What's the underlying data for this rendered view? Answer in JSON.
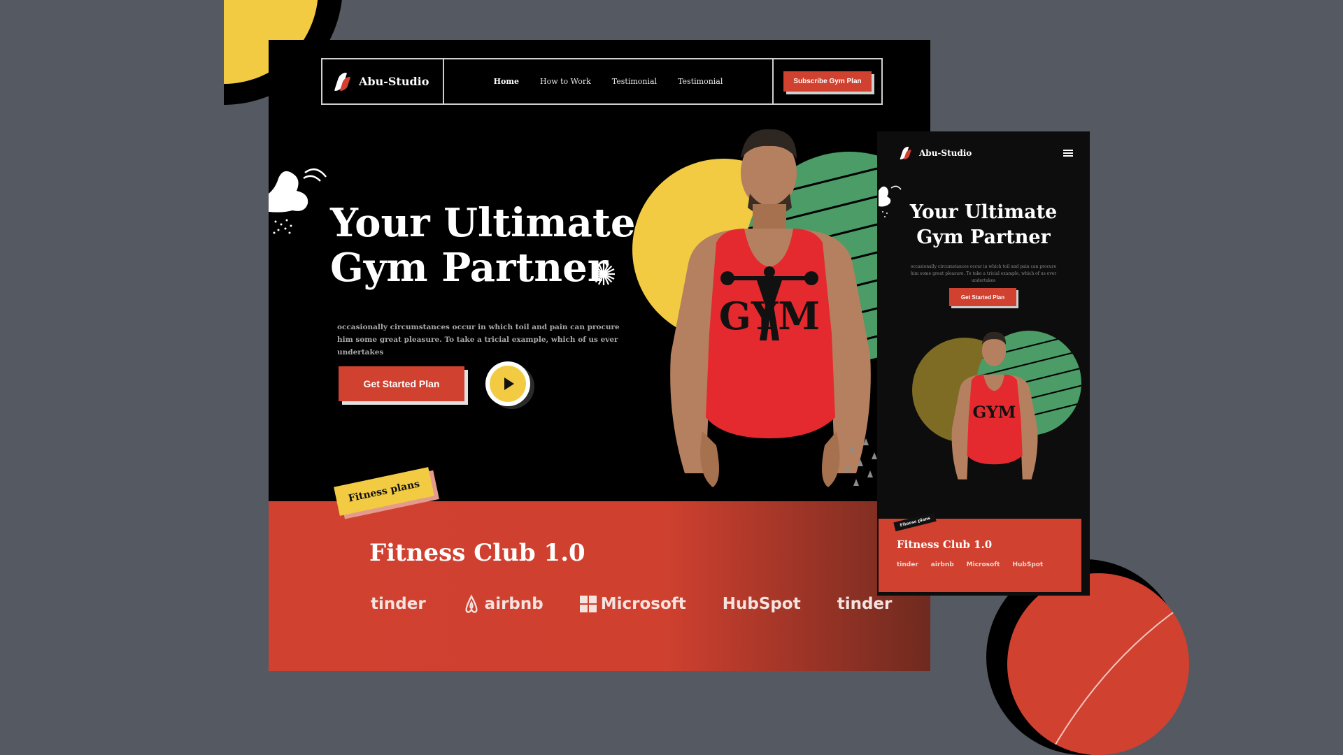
{
  "colors": {
    "background": "#545962",
    "accent_red": "#d14130",
    "accent_yellow": "#f3cb43",
    "accent_green": "#4b9c67",
    "dark": "#000000",
    "white": "#ffffff"
  },
  "desktop": {
    "brand": {
      "name": "Abu-Studio",
      "icon": "flame-logo-icon"
    },
    "nav": {
      "links": [
        "Home",
        "How to Work",
        "Testimonial",
        "Testimonial"
      ],
      "active": "Home",
      "cta_label": "Subscribe Gym Plan"
    },
    "hero": {
      "title_line1": "Your Ultimate",
      "title_line2": "Gym Partner",
      "description": "occasionally circumstances occur in which toil and pain can procure him some great pleasure. To take a tricial example, which of us ever undertakes",
      "cta_label": "Get Started Plan",
      "play_icon": "play-icon",
      "shirt_text": "GYM"
    },
    "plans": {
      "tag": "Fitness plans",
      "title": "Fitness Club 1.0",
      "logos": [
        "tinder",
        "airbnb",
        "Microsoft",
        "HubSpot",
        "tinder"
      ]
    }
  },
  "mobile": {
    "brand": {
      "name": "Abu-Studio"
    },
    "menu_icon": "hamburger-menu-icon",
    "hero": {
      "title_line1": "Your Ultimate",
      "title_line2": "Gym Partner",
      "description": "occasionally circumstances occur in which toil and pain can procure him some great pleasure. To take a tricial example, which of us ever undertakes",
      "cta_label": "Get Started Plan",
      "shirt_text": "GYM"
    },
    "plans": {
      "tag": "Fitness plans",
      "title": "Fitness Club 1.0",
      "logos": [
        "tinder",
        "airbnb",
        "Microsoft",
        "HubSpot"
      ]
    }
  }
}
